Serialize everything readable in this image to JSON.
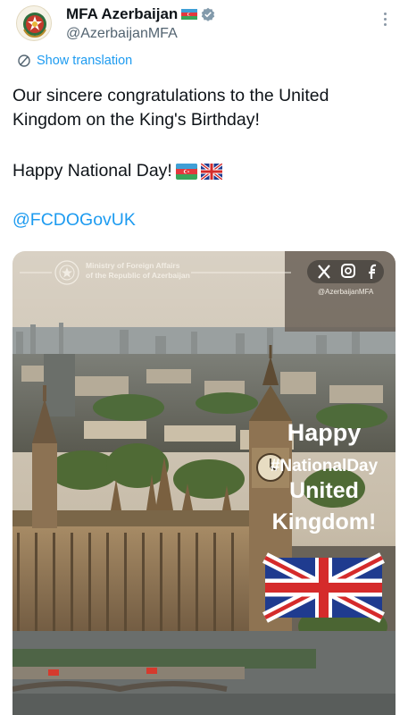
{
  "account": {
    "display_name": "MFA Azerbaijan",
    "handle": "@AzerbaijanMFA",
    "verified": true
  },
  "translate": {
    "label": "Show translation",
    "icon": "translate-icon"
  },
  "tweet": {
    "line1": "Our sincere congratulations to the United Kingdom on the King's Birthday!",
    "line2": "Happy National Day!",
    "mention": "@FCDOGovUK"
  },
  "media": {
    "org_line1": "Ministry of Foreign Affairs",
    "org_line2": "of the Republic of Azerbaijan",
    "social_handle": "@AzerbaijanMFA",
    "social_icons": [
      "x-logo-icon",
      "instagram-icon",
      "facebook-icon"
    ],
    "headline1": "Happy",
    "headline2": "#NationalDay",
    "headline3": "United",
    "headline4": "Kingdom!"
  },
  "colors": {
    "link": "#1d9bf0",
    "text": "#0f1419",
    "muted": "#536471",
    "verified": "#829aab"
  }
}
